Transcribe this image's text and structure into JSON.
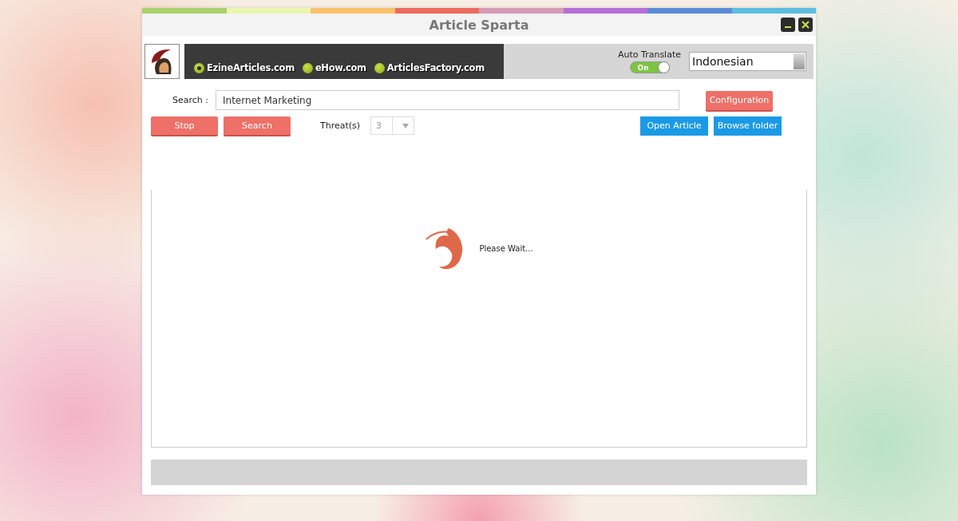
{
  "window": {
    "title": "Article Sparta"
  },
  "sites": [
    {
      "label": "EzineArticles.com",
      "selected": true
    },
    {
      "label": "eHow.com",
      "selected": false
    },
    {
      "label": "ArticlesFactory.com",
      "selected": false
    }
  ],
  "auto_translate": {
    "label": "Auto Translate",
    "on": true,
    "state_text": "On"
  },
  "language": {
    "value": "Indonesian"
  },
  "search": {
    "label": "Search :",
    "value": "Internet Marketing"
  },
  "configuration_button": {
    "label": "Configuration",
    "kind": "red"
  },
  "action_buttons": [
    {
      "label": "Stop",
      "kind": "red"
    },
    {
      "label": "Search",
      "kind": "red"
    }
  ],
  "threads": {
    "label": "Threat(s)",
    "value": "3"
  },
  "file_buttons": [
    {
      "label": "Open Article",
      "kind": "blue"
    },
    {
      "label": "Browse folder",
      "kind": "blue"
    }
  ],
  "status": {
    "text": "Please Wait..."
  }
}
